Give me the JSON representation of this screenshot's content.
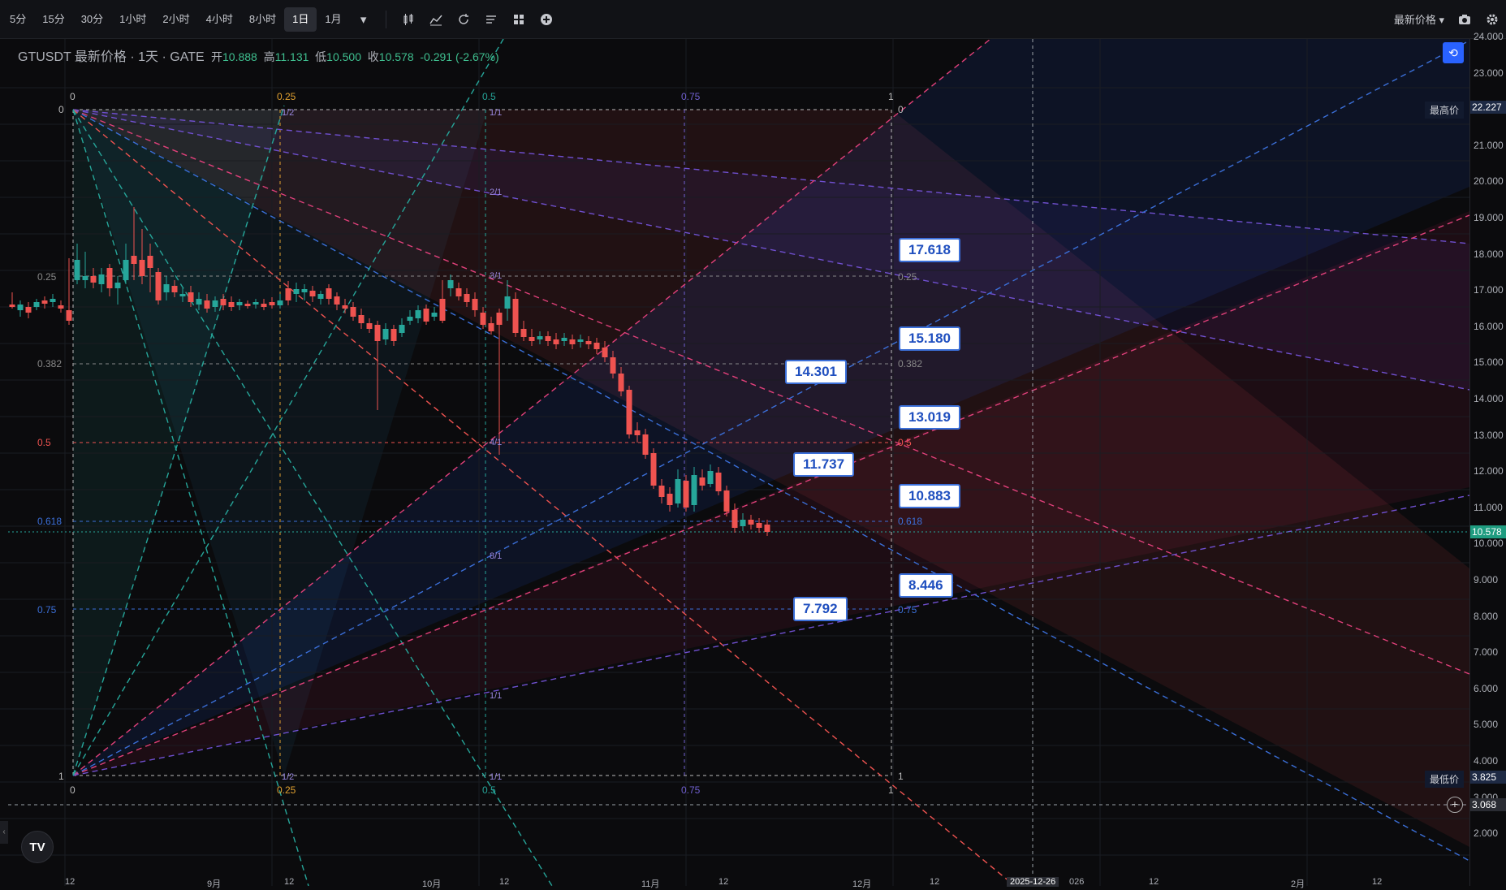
{
  "toolbar": {
    "timeframes": [
      "5分",
      "15分",
      "30分",
      "1小时",
      "2小时",
      "4小时",
      "8小时",
      "1日",
      "1月"
    ],
    "active_timeframe": "1日",
    "icons": [
      "candles-icon",
      "indicator-icon",
      "replay-icon",
      "strategy-icon",
      "layout-icon",
      "add-icon"
    ],
    "price_type": "最新价格",
    "right_icons": [
      "camera-icon",
      "settings-icon"
    ]
  },
  "symbol": {
    "title": "GTUSDT 最新价格 · 1天 · GATE",
    "open_label": "开",
    "open": "10.888",
    "high_label": "高",
    "high": "11.131",
    "low_label": "低",
    "low": "10.500",
    "close_label": "收",
    "close": "10.578",
    "change": "-0.291 (-2.67%)"
  },
  "price_axis": {
    "labels": [
      "24.000",
      "23.000",
      "22.000",
      "21.000",
      "20.000",
      "19.000",
      "18.000",
      "17.000",
      "16.000",
      "15.000",
      "14.000",
      "13.000",
      "12.000",
      "11.000",
      "10.000",
      "9.000",
      "8.000",
      "7.000",
      "6.000",
      "5.000",
      "4.000",
      "3.000",
      "2.000"
    ],
    "highest_label": "最高价",
    "highest_value": "22.227",
    "lowest_label": "最低价",
    "lowest_value": "3.825",
    "current_price": "10.578",
    "crosshair_price": "3.068"
  },
  "fib_levels": {
    "top": [
      "0",
      "0.25",
      "0.5",
      "0.75",
      "1"
    ],
    "left": [
      "0",
      "0.25",
      "0.382",
      "0.5",
      "0.618",
      "0.75",
      "1"
    ],
    "right": [
      "0",
      "0.25",
      "0.382",
      "0.5",
      "0.618",
      "0.75",
      "1"
    ],
    "ratios": [
      "1/2",
      "1/1",
      "2/1",
      "3/1",
      "4/1",
      "8/1",
      "1/1",
      "1/2",
      "1/1",
      "3/1",
      "4/1",
      "8/1"
    ]
  },
  "callouts": [
    "17.618",
    "15.180",
    "14.301",
    "13.019",
    "11.737",
    "10.883",
    "8.446",
    "7.792"
  ],
  "time_axis": {
    "labels": [
      "12",
      "9月",
      "12",
      "10月",
      "12",
      "11月",
      "12",
      "12月",
      "12",
      "2025-12-26",
      "026",
      "12",
      "2月",
      "12"
    ]
  },
  "colors": {
    "bull": "#26a69a",
    "bear": "#ef5350",
    "accent": "#2962ff",
    "callout_text": "#1f4fbf"
  }
}
